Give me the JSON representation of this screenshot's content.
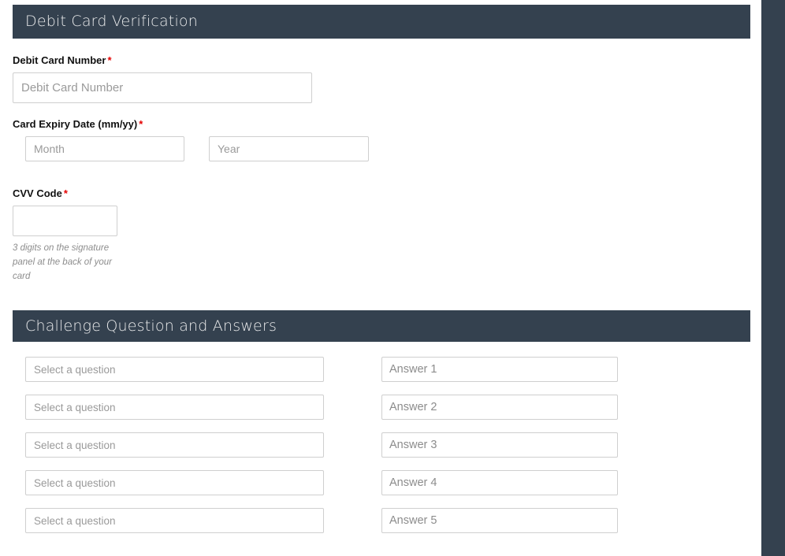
{
  "colors": {
    "section_bar": "#34414f",
    "section_title_text": "#e9eaeb",
    "required_asterisk": "#e40000",
    "input_border": "#cfcfcf",
    "placeholder": "#9a9a9a",
    "hint_text": "#8d8d8d",
    "page_background": "#ffffff",
    "edge_band": "#34414f"
  },
  "card_section": {
    "title": "Debit Card Verification",
    "card_number": {
      "label": "Debit Card Number",
      "required_marker": "*",
      "placeholder": "Debit Card Number",
      "value": ""
    },
    "expiry": {
      "label": "Card Expiry Date (mm/yy)",
      "required_marker": "*",
      "month": {
        "placeholder": "Month",
        "value": ""
      },
      "year": {
        "placeholder": "Year",
        "value": ""
      }
    },
    "cvv": {
      "label": "CVV Code",
      "required_marker": "*",
      "placeholder": "",
      "value": "",
      "hint": "3 digits on the signature panel at the back of your card"
    }
  },
  "challenge_section": {
    "title": "Challenge Question and Answers",
    "question_placeholder": "Select a question",
    "rows": [
      {
        "question_selected": "Select a question",
        "answer_placeholder": "Answer 1",
        "answer_value": ""
      },
      {
        "question_selected": "Select a question",
        "answer_placeholder": "Answer 2",
        "answer_value": ""
      },
      {
        "question_selected": "Select a question",
        "answer_placeholder": "Answer 3",
        "answer_value": ""
      },
      {
        "question_selected": "Select a question",
        "answer_placeholder": "Answer 4",
        "answer_value": ""
      },
      {
        "question_selected": "Select a question",
        "answer_placeholder": "Answer 5",
        "answer_value": ""
      }
    ]
  }
}
